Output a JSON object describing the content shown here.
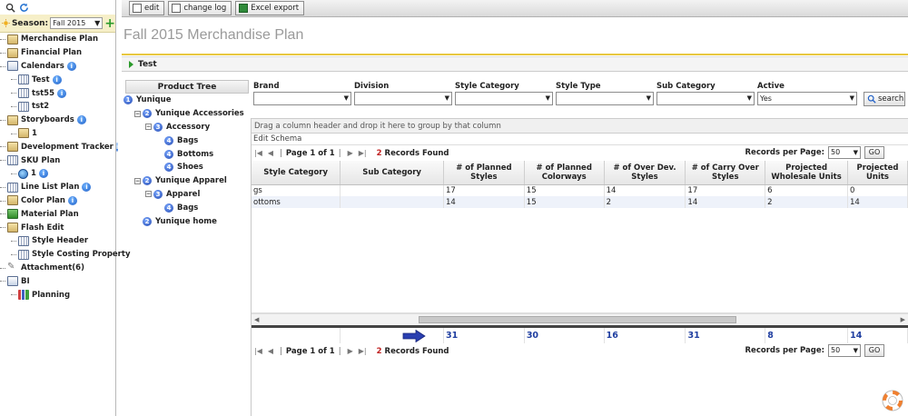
{
  "sidebar": {
    "season_label": "Season:",
    "season_value": "Fall 2015",
    "items": [
      {
        "label": "Merchandise Plan",
        "indent": 0,
        "icon": "folder",
        "info": false
      },
      {
        "label": "Financial Plan",
        "indent": 0,
        "icon": "folder",
        "info": false
      },
      {
        "label": "Calendars",
        "indent": 0,
        "icon": "cal",
        "info": true
      },
      {
        "label": "Test",
        "indent": 1,
        "icon": "grid",
        "info": true
      },
      {
        "label": "tst55",
        "indent": 1,
        "icon": "grid",
        "info": true
      },
      {
        "label": "tst2",
        "indent": 1,
        "icon": "grid",
        "info": false
      },
      {
        "label": "Storyboards",
        "indent": 0,
        "icon": "folder",
        "info": true
      },
      {
        "label": "1",
        "indent": 1,
        "icon": "folder",
        "info": false
      },
      {
        "label": "Development Tracker",
        "indent": 0,
        "icon": "folder",
        "info": true
      },
      {
        "label": "SKU Plan",
        "indent": 0,
        "icon": "grid",
        "info": false
      },
      {
        "label": "1",
        "indent": 1,
        "icon": "globe",
        "info": true
      },
      {
        "label": "Line List Plan",
        "indent": 0,
        "icon": "grid",
        "info": true
      },
      {
        "label": "Color Plan",
        "indent": 0,
        "icon": "folder",
        "info": true
      },
      {
        "label": "Material Plan",
        "indent": 0,
        "icon": "tree",
        "info": false
      },
      {
        "label": "Flash Edit",
        "indent": 0,
        "icon": "folder",
        "info": false
      },
      {
        "label": "Style Header",
        "indent": 1,
        "icon": "grid",
        "info": false
      },
      {
        "label": "Style Costing Property",
        "indent": 1,
        "icon": "grid",
        "info": false
      },
      {
        "label": "Attachment(6)",
        "indent": 0,
        "icon": "clip",
        "info": false
      },
      {
        "label": "BI",
        "indent": 0,
        "icon": "cal",
        "info": false
      },
      {
        "label": "Planning",
        "indent": 1,
        "icon": "bars",
        "info": false
      }
    ]
  },
  "toolbar": {
    "edit_label": "edit",
    "changelog_label": "change log",
    "excel_label": "Excel export"
  },
  "page": {
    "title": "Fall 2015 Merchandise Plan",
    "section": "Test"
  },
  "product_tree": {
    "header": "Product Tree",
    "nodes": [
      {
        "label": "Yunique",
        "level": 0,
        "num": "1",
        "toggle": ""
      },
      {
        "label": "Yunique Accessories",
        "level": 1,
        "num": "2",
        "toggle": "-"
      },
      {
        "label": "Accessory",
        "level": 2,
        "num": "3",
        "toggle": "-"
      },
      {
        "label": "Bags",
        "level": 3,
        "num": "4",
        "toggle": ""
      },
      {
        "label": "Bottoms",
        "level": 3,
        "num": "4",
        "toggle": ""
      },
      {
        "label": "Shoes",
        "level": 3,
        "num": "4",
        "toggle": ""
      },
      {
        "label": "Yunique Apparel",
        "level": 1,
        "num": "2",
        "toggle": "-"
      },
      {
        "label": "Apparel",
        "level": 2,
        "num": "3",
        "toggle": "-"
      },
      {
        "label": "Bags",
        "level": 3,
        "num": "4",
        "toggle": ""
      },
      {
        "label": "Yunique home",
        "level": 1,
        "num": "2",
        "toggle": ""
      }
    ]
  },
  "filters": {
    "brand": "Brand",
    "division": "Division",
    "style_category": "Style Category",
    "style_type": "Style Type",
    "sub_category": "Sub Category",
    "active": "Active",
    "active_value": "Yes",
    "search_label": "search"
  },
  "grid": {
    "group_hint": "Drag a column header and drop it here to group by that column",
    "edit_schema": "Edit Schema",
    "pager_text": "Page 1 of 1",
    "records_count": "2",
    "records_label": "Records Found",
    "rpp_label": "Records per Page:",
    "rpp_value": "50",
    "go_label": "GO",
    "columns": [
      "Style Category",
      "Sub Category",
      "# of Planned Styles",
      "# of Planned Colorways",
      "# of Over Dev. Styles",
      "# of Carry Over Styles",
      "Projected Wholesale Units",
      "Projected Units"
    ],
    "rows": [
      [
        "gs",
        "",
        "17",
        "15",
        "14",
        "17",
        "6",
        "0"
      ],
      [
        "ottoms",
        "",
        "14",
        "15",
        "2",
        "14",
        "2",
        "14"
      ]
    ],
    "totals": [
      "",
      "",
      "31",
      "30",
      "16",
      "31",
      "8",
      "14"
    ]
  }
}
